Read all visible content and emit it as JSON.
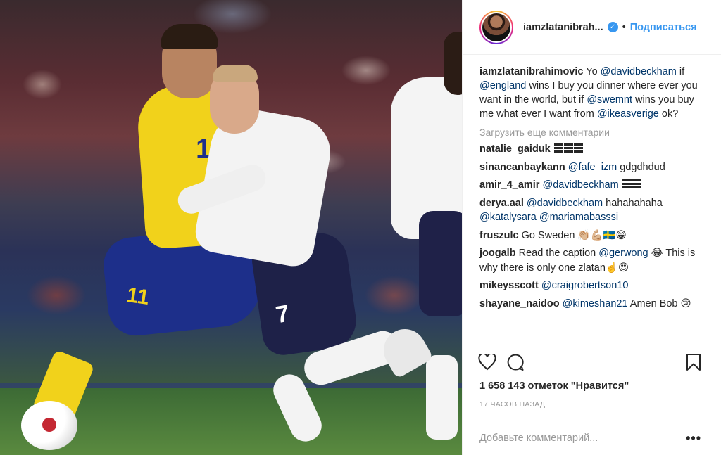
{
  "post": {
    "photo_alt": "Football match photo",
    "shirt_numbers": {
      "sweden_player": "11",
      "sweden_shorts": "11",
      "england_player": "7"
    }
  },
  "header": {
    "username": "iamzlatanibrah...",
    "dot": "•",
    "follow_label": "Подписаться",
    "verified_glyph": "✓"
  },
  "caption": {
    "username": "iamzlatanibrahimovic",
    "parts": [
      {
        "t": "text",
        "v": " Yo "
      },
      {
        "t": "mention",
        "v": "@davidbeckham"
      },
      {
        "t": "text",
        "v": " if "
      },
      {
        "t": "mention",
        "v": "@england"
      },
      {
        "t": "text",
        "v": " wins I buy you dinner where ever you want in the world, but if "
      },
      {
        "t": "mention",
        "v": "@swemnt"
      },
      {
        "t": "text",
        "v": " wins you buy me what ever I want from "
      },
      {
        "t": "mention",
        "v": "@ikeasverige"
      },
      {
        "t": "text",
        "v": " ok?"
      }
    ]
  },
  "load_more_label": "Загрузить еще комментарии",
  "comments": [
    {
      "user": "natalie_gaiduk",
      "parts": [
        {
          "t": "bars",
          "v": 3
        }
      ]
    },
    {
      "user": "sinancanbaykann",
      "parts": [
        {
          "t": "mention",
          "v": "@fafe_izm"
        },
        {
          "t": "text",
          "v": " gdgdhdud"
        }
      ]
    },
    {
      "user": "amir_4_amir",
      "parts": [
        {
          "t": "mention",
          "v": "@davidbeckham"
        },
        {
          "t": "text",
          "v": " "
        },
        {
          "t": "bars",
          "v": 2
        }
      ]
    },
    {
      "user": "derya.aal",
      "parts": [
        {
          "t": "mention",
          "v": "@davidbeckham"
        },
        {
          "t": "text",
          "v": " hahahahaha "
        },
        {
          "t": "mention",
          "v": "@katalysara"
        },
        {
          "t": "text",
          "v": " "
        },
        {
          "t": "mention",
          "v": "@mariamabasssi"
        }
      ]
    },
    {
      "user": "fruszulc",
      "parts": [
        {
          "t": "text",
          "v": "Go Sweden 👏🏼💪🏼🇸🇪😁"
        }
      ]
    },
    {
      "user": "joogalb",
      "parts": [
        {
          "t": "text",
          "v": "Read the caption "
        },
        {
          "t": "mention",
          "v": "@gerwong"
        },
        {
          "t": "text",
          "v": " 😂 This is why there is only one zlatan☝️😍"
        }
      ]
    },
    {
      "user": "mikeysscott",
      "parts": [
        {
          "t": "mention",
          "v": "@craigrobertson10"
        }
      ]
    },
    {
      "user": "shayane_naidoo",
      "parts": [
        {
          "t": "mention",
          "v": "@kimeshan21"
        },
        {
          "t": "text",
          "v": " Amen Bob 😢"
        }
      ]
    }
  ],
  "actions": {
    "like_icon": "heart-icon",
    "comment_icon": "comment-icon",
    "save_icon": "bookmark-icon"
  },
  "likes_label": "1 658 143 отметок \"Нравится\"",
  "time_ago": "17 ЧАСОВ НАЗАД",
  "add_comment": {
    "placeholder": "Добавьте комментарий...",
    "more_label": "•••"
  },
  "colors": {
    "link": "#003569",
    "follow": "#3897f0",
    "muted": "#999999"
  }
}
